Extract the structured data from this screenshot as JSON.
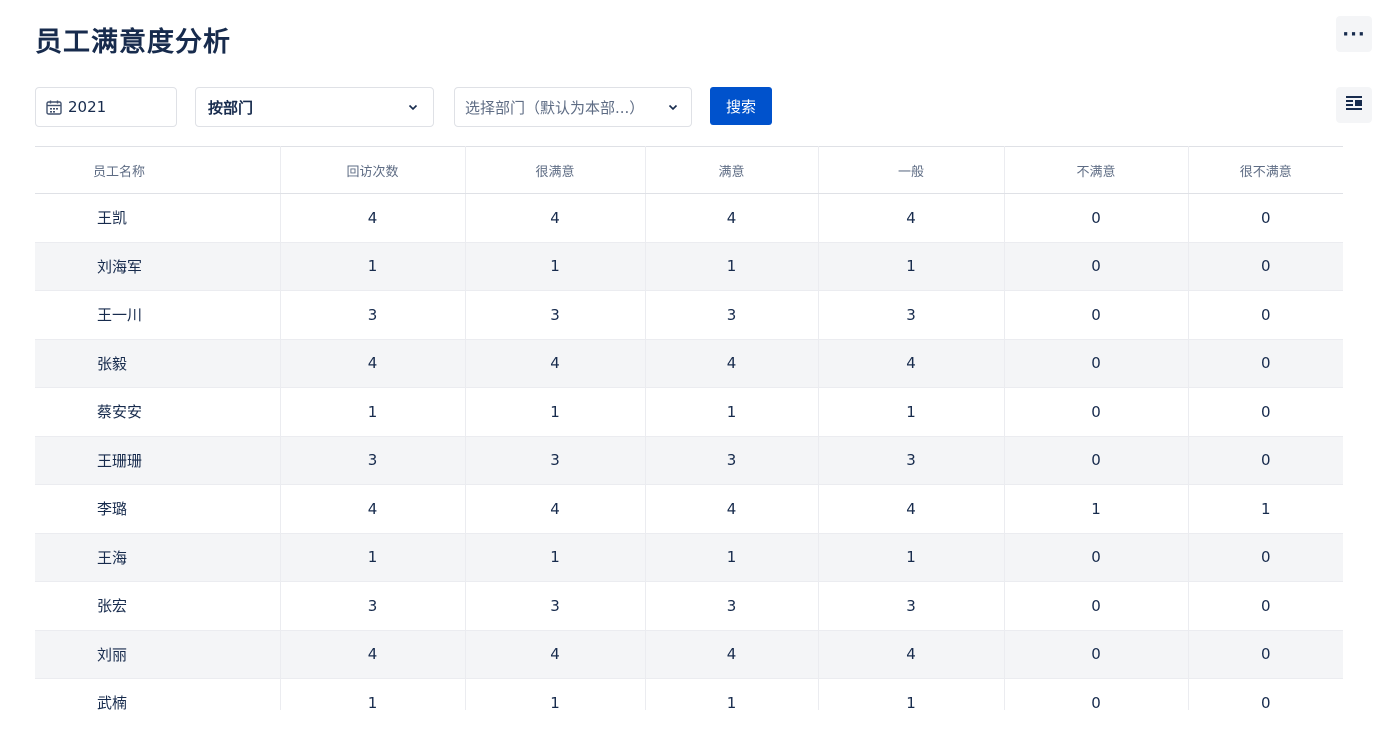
{
  "page": {
    "title": "员工满意度分析"
  },
  "toolbar": {
    "year": "2021",
    "dimension": "按部门",
    "department_placeholder": "选择部门（默认为本部...）",
    "search_label": "搜索"
  },
  "table": {
    "headers": [
      "员工名称",
      "回访次数",
      "很满意",
      "满意",
      "一般",
      "不满意",
      "很不满意"
    ],
    "rows": [
      [
        "王凯",
        "4",
        "4",
        "4",
        "4",
        "0",
        "0"
      ],
      [
        "刘海军",
        "1",
        "1",
        "1",
        "1",
        "0",
        "0"
      ],
      [
        "王一川",
        "3",
        "3",
        "3",
        "3",
        "0",
        "0"
      ],
      [
        "张毅",
        "4",
        "4",
        "4",
        "4",
        "0",
        "0"
      ],
      [
        "蔡安安",
        "1",
        "1",
        "1",
        "1",
        "0",
        "0"
      ],
      [
        "王珊珊",
        "3",
        "3",
        "3",
        "3",
        "0",
        "0"
      ],
      [
        "李璐",
        "4",
        "4",
        "4",
        "4",
        "1",
        "1"
      ],
      [
        "王海",
        "1",
        "1",
        "1",
        "1",
        "0",
        "0"
      ],
      [
        "张宏",
        "3",
        "3",
        "3",
        "3",
        "0",
        "0"
      ],
      [
        "刘丽",
        "4",
        "4",
        "4",
        "4",
        "0",
        "0"
      ],
      [
        "武楠",
        "1",
        "1",
        "1",
        "1",
        "0",
        "0"
      ]
    ]
  },
  "icons": {
    "more": "more-horizontal-icon",
    "calendar": "calendar-icon",
    "chevron": "chevron-down-icon",
    "columns": "table-columns-icon"
  },
  "colors": {
    "primary": "#0052cc",
    "text": "#172b4d",
    "row_alt": "#f4f5f7"
  }
}
